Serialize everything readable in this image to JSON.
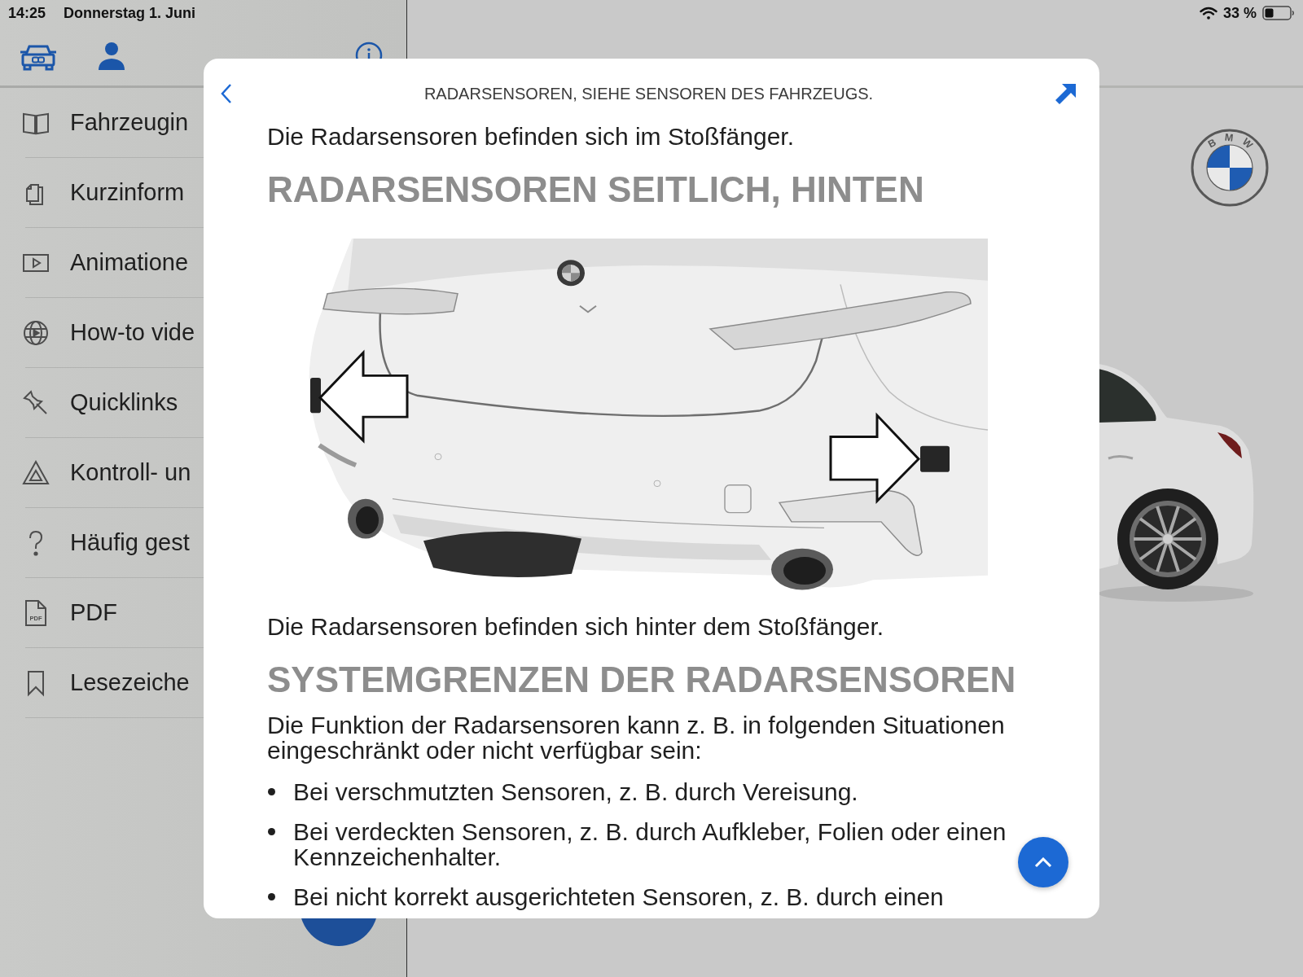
{
  "status_bar": {
    "time": "14:25",
    "date": "Donnerstag 1. Juni",
    "battery_text": "33 %"
  },
  "sidebar": {
    "items": [
      {
        "label": "Fahrzeugin",
        "selected": false
      },
      {
        "label": "Kurzinform",
        "selected": false
      },
      {
        "label": "Animatione",
        "selected": false
      },
      {
        "label": "How-to vide",
        "selected": false
      },
      {
        "label": "Quicklinks",
        "selected": false
      },
      {
        "label": "Kontroll- un",
        "selected": false
      },
      {
        "label": "Häufig gest",
        "selected": false
      },
      {
        "label": "PDF",
        "selected": false,
        "icon_text": "PDF"
      },
      {
        "label": "Lesezeiche",
        "selected": false
      }
    ]
  },
  "brand_logo": {
    "text": "BMW"
  },
  "dialog": {
    "title": "RADARSENSOREN, SIEHE SENSOREN DES FAHRZEUGS.",
    "content": [
      {
        "kind": "paragraph",
        "text": "Die Radarsensoren befinden sich im Stoßfänger."
      },
      {
        "kind": "heading",
        "text": "RADARSENSOREN SEITLICH, HINTEN"
      },
      {
        "kind": "illustration"
      },
      {
        "kind": "paragraph",
        "text": "Die Radarsensoren befinden sich hinter dem Stoßfänger."
      },
      {
        "kind": "heading",
        "text": "SYSTEMGRENZEN DER RADARSENSOREN"
      },
      {
        "kind": "paragraph",
        "text": "Die Funktion der Radarsensoren kann z. B. in folgenden Situationen eingeschränkt oder nicht verfügbar sein:"
      },
      {
        "kind": "bullet_list",
        "items": [
          "Bei verschmutzten Sensoren, z. B. durch Vereisung.",
          "Bei verdeckten Sensoren, z. B. durch Aufkleber, Folien oder einen Kennzeichenhalter.",
          "Bei nicht korrekt ausgerichteten Sensoren, z. B. durch einen"
        ]
      }
    ]
  }
}
